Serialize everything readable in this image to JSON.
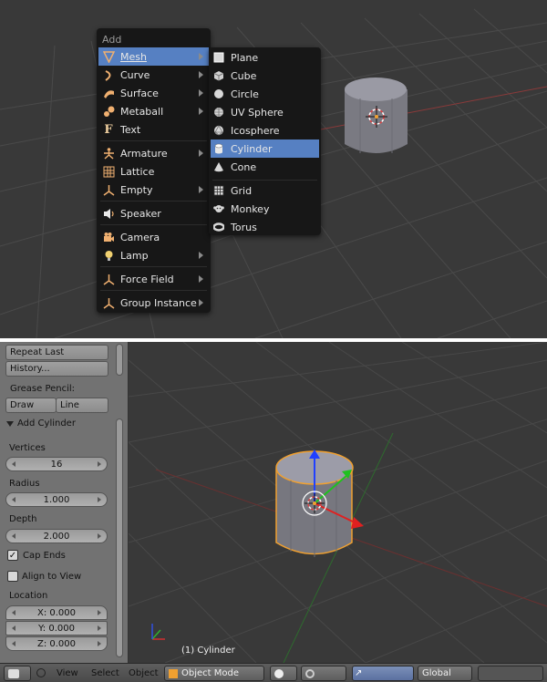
{
  "add_menu": {
    "title": "Add",
    "items": [
      {
        "label": "Mesh",
        "icon": "mesh-icon",
        "submenu": true,
        "active": true
      },
      {
        "label": "Curve",
        "icon": "curve-icon",
        "submenu": true
      },
      {
        "label": "Surface",
        "icon": "surface-icon",
        "submenu": true
      },
      {
        "label": "Metaball",
        "icon": "metaball-icon",
        "submenu": true
      },
      {
        "label": "Text",
        "icon": "text-icon",
        "submenu": false
      },
      {
        "label": "Armature",
        "icon": "armature-icon",
        "submenu": true
      },
      {
        "label": "Lattice",
        "icon": "lattice-icon",
        "submenu": false
      },
      {
        "label": "Empty",
        "icon": "empty-icon",
        "submenu": true
      },
      {
        "label": "Speaker",
        "icon": "speaker-icon",
        "submenu": false
      },
      {
        "label": "Camera",
        "icon": "camera-icon",
        "submenu": false
      },
      {
        "label": "Lamp",
        "icon": "lamp-icon",
        "submenu": true
      },
      {
        "label": "Force Field",
        "icon": "force-field-icon",
        "submenu": true
      },
      {
        "label": "Group Instance",
        "icon": "group-instance-icon",
        "submenu": true
      }
    ]
  },
  "mesh_menu": {
    "items": [
      {
        "label": "Plane",
        "icon": "plane-icon"
      },
      {
        "label": "Cube",
        "icon": "cube-icon"
      },
      {
        "label": "Circle",
        "icon": "circle-icon"
      },
      {
        "label": "UV Sphere",
        "icon": "uv-sphere-icon"
      },
      {
        "label": "Icosphere",
        "icon": "icosphere-icon"
      },
      {
        "label": "Cylinder",
        "icon": "cylinder-icon",
        "active": true
      },
      {
        "label": "Cone",
        "icon": "cone-icon"
      },
      {
        "label": "Grid",
        "icon": "grid-icon"
      },
      {
        "label": "Monkey",
        "icon": "monkey-icon"
      },
      {
        "label": "Torus",
        "icon": "torus-icon"
      }
    ]
  },
  "tool_shelf": {
    "repeat_last": "Repeat Last",
    "history": "History...",
    "grease_pencil_label": "Grease Pencil:",
    "draw": "Draw",
    "line": "Line",
    "operator_title": "Add Cylinder",
    "vertices_label": "Vertices",
    "vertices_value": "16",
    "radius_label": "Radius",
    "radius_value": "1.000",
    "depth_label": "Depth",
    "depth_value": "2.000",
    "cap_ends_label": "Cap Ends",
    "cap_ends_checked": true,
    "align_to_view_label": "Align to View",
    "align_to_view_checked": false,
    "location_label": "Location",
    "loc_x": "X: 0.000",
    "loc_y": "Y: 0.000",
    "loc_z": "Z: 0.000"
  },
  "viewport": {
    "selected_object": "(1) Cylinder"
  },
  "header": {
    "view": "View",
    "select": "Select",
    "object": "Object",
    "mode": "Object Mode",
    "orientation": "Global"
  },
  "colors": {
    "viewport_bg": "#393939",
    "menu_bg": "#171717",
    "highlight": "#5680c2",
    "tool_shelf_bg": "#727272",
    "selection_outline": "#f0a030"
  }
}
